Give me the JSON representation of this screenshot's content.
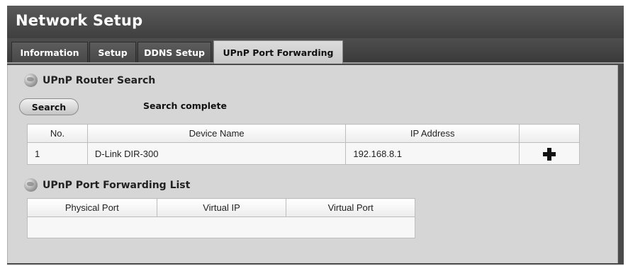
{
  "header": {
    "title": "Network Setup"
  },
  "tabs": [
    {
      "label": "Information"
    },
    {
      "label": "Setup"
    },
    {
      "label": "DDNS Setup"
    },
    {
      "label": "UPnP Port Forwarding",
      "active": true
    }
  ],
  "router_search": {
    "heading": "UPnP Router Search",
    "search_button": "Search",
    "status": "Search complete",
    "columns": [
      "No.",
      "Device Name",
      "IP Address",
      ""
    ],
    "rows": [
      {
        "no": "1",
        "device_name": "D-Link DIR-300",
        "ip_address": "192.168.8.1",
        "action_icon": "plus-icon"
      }
    ]
  },
  "port_forwarding": {
    "heading": "UPnP Port Forwarding List",
    "columns": [
      "Physical Port",
      "Virtual IP",
      "Virtual Port"
    ],
    "rows": []
  },
  "colors": {
    "header_bg": "#4a4a4a",
    "active_tab_bg": "#d2d2d2",
    "panel_bg": "#d6d6d6"
  }
}
